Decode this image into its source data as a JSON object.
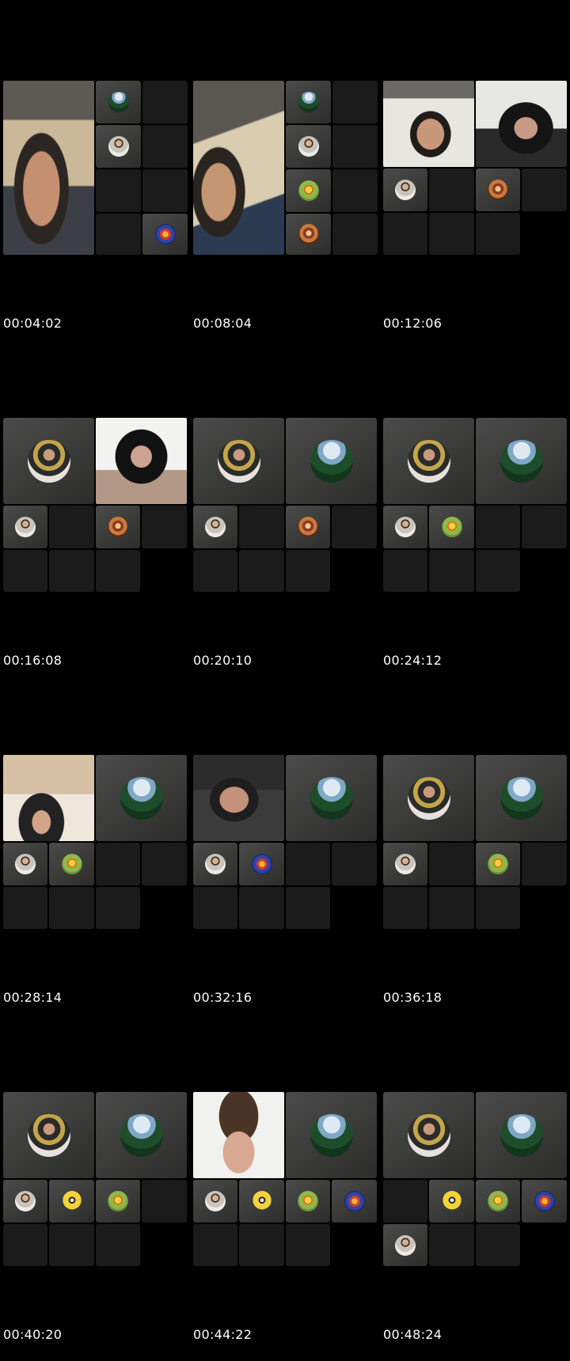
{
  "thumbnails": [
    {
      "timestamp": "00:04:02"
    },
    {
      "timestamp": "00:08:04"
    },
    {
      "timestamp": "00:12:06"
    },
    {
      "timestamp": "00:16:08"
    },
    {
      "timestamp": "00:20:10"
    },
    {
      "timestamp": "00:24:12"
    },
    {
      "timestamp": "00:28:14"
    },
    {
      "timestamp": "00:32:16"
    },
    {
      "timestamp": "00:36:18"
    },
    {
      "timestamp": "00:40:20"
    },
    {
      "timestamp": "00:44:22"
    },
    {
      "timestamp": "00:48:24"
    }
  ],
  "colors": {
    "background": "#000000",
    "empty_tile": "#1b1b1b",
    "avatar_tile": "#3f3f3e",
    "timestamp_text": "#ffffff"
  },
  "icons": [
    "avatar-sky",
    "avatar-man",
    "avatar-bart",
    "avatar-tshirt",
    "avatar-minion",
    "avatar-randy",
    "avatar-bear"
  ]
}
